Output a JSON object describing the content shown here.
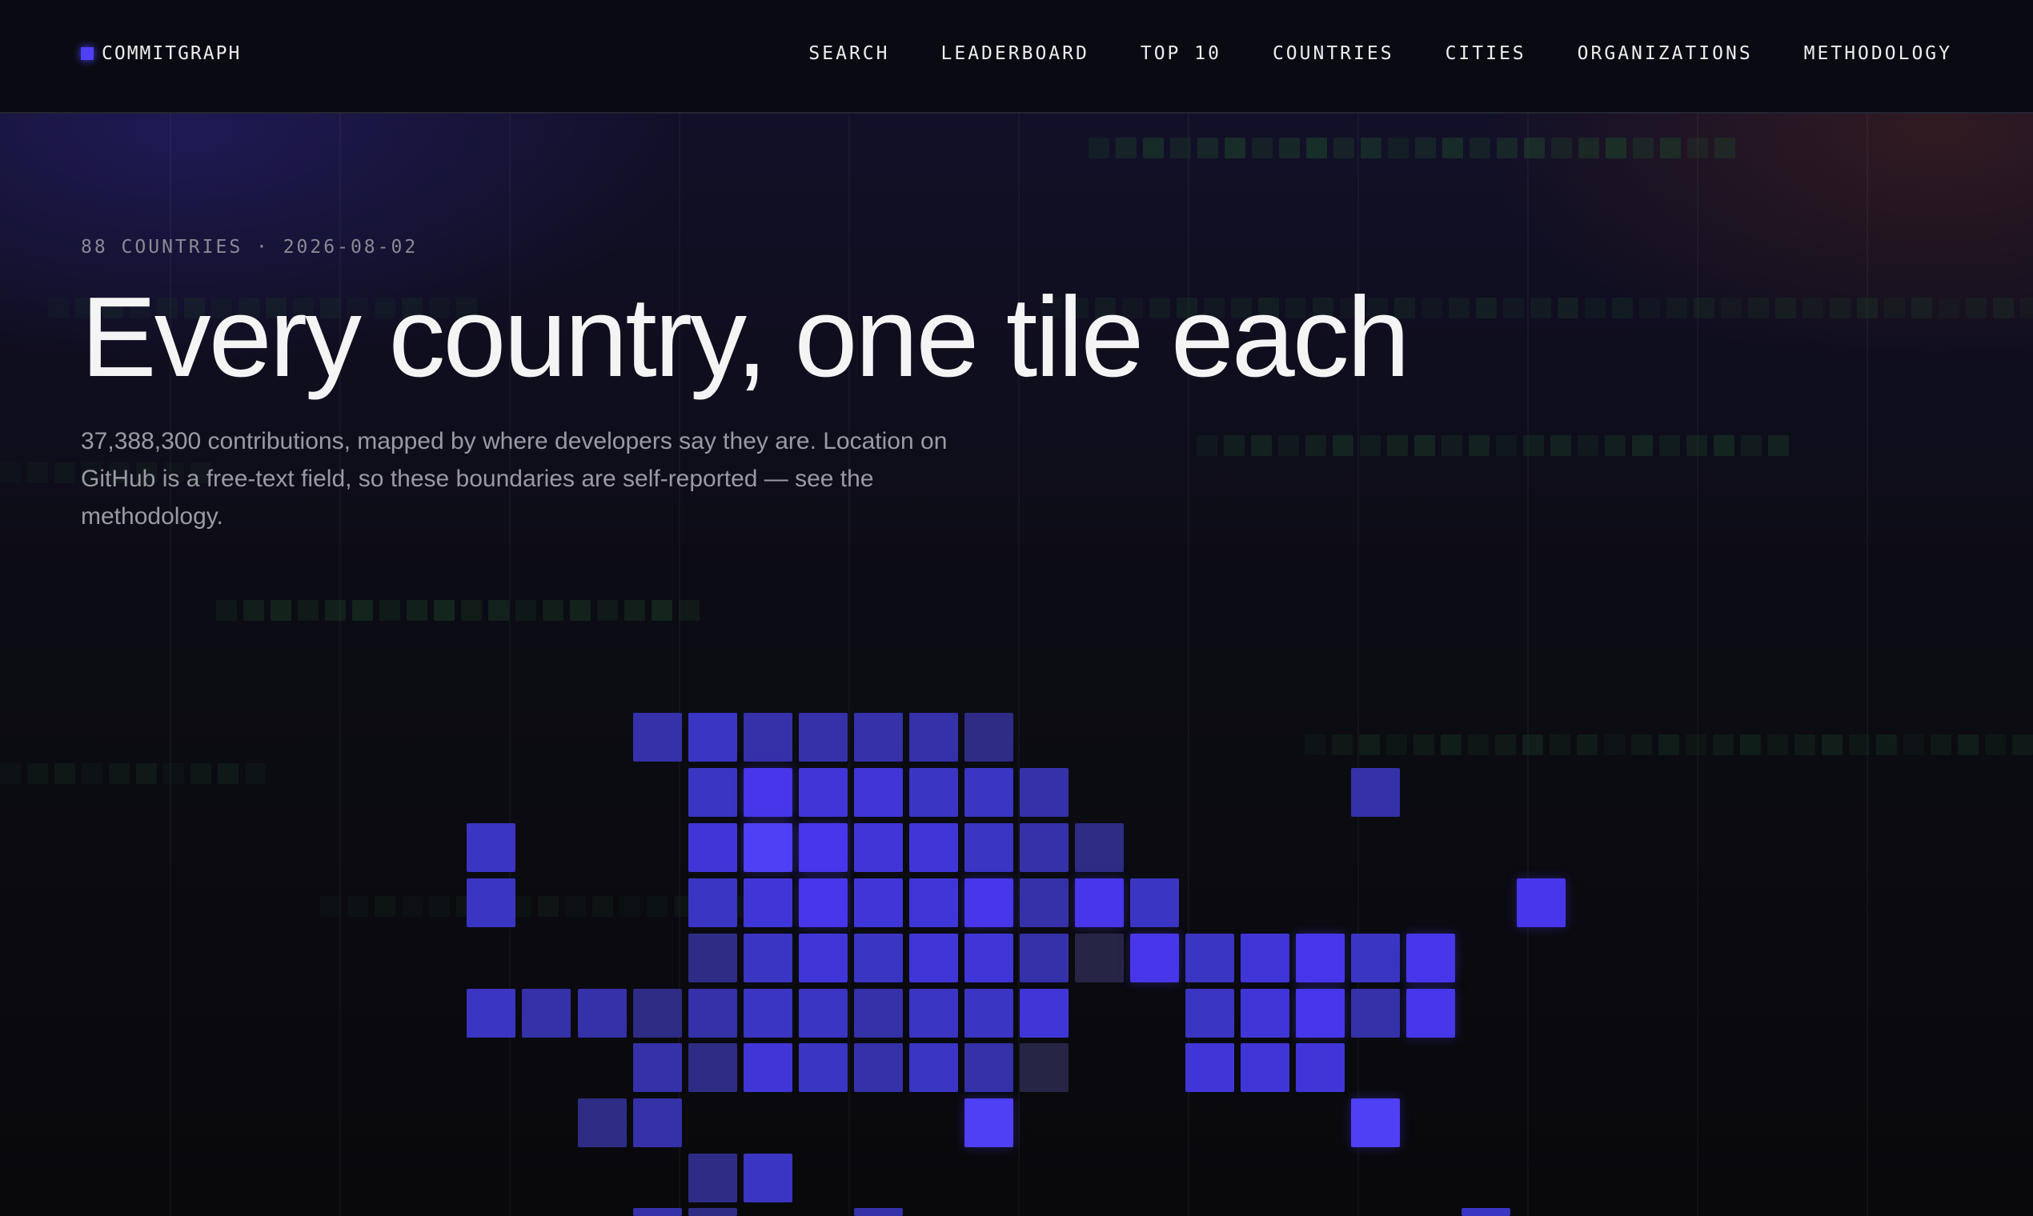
{
  "nav": {
    "brand": "COMMITGRAPH",
    "links": [
      "SEARCH",
      "LEADERBOARD",
      "TOP 10",
      "COUNTRIES",
      "CITIES",
      "ORGANIZATIONS",
      "METHODOLOGY"
    ]
  },
  "hero": {
    "meta": "88 COUNTRIES · 2026-08-02",
    "title": "Every country, one tile each",
    "description": "37,388,300 contributions, mapped by where developers say they are. Location on GitHub is a free-text field, so these boundaries are self-reported — see the methodology."
  },
  "colors": {
    "accent": "#4f3ff5",
    "tile_scale": [
      "#272545",
      "#2f2c85",
      "#3531a8",
      "#3a35c2",
      "#4036d8",
      "#4736ea",
      "#4f3ff5"
    ],
    "contribution_green": "#1f4a2a"
  }
}
